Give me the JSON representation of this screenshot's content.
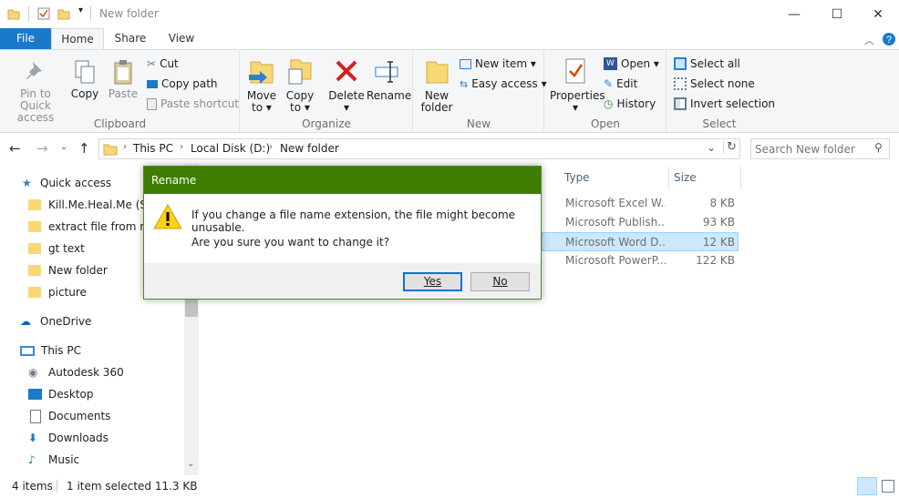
{
  "titlebar": {
    "title": "New folder",
    "minimize": "—",
    "maximize": "☐",
    "close": "✕"
  },
  "tabs": {
    "file": "File",
    "home": "Home",
    "share": "Share",
    "view": "View"
  },
  "ribbon": {
    "clipboard": {
      "label": "Clipboard",
      "pin": "Pin to Quick",
      "pin2": "access",
      "copy": "Copy",
      "paste": "Paste",
      "cut": "Cut",
      "copy_path": "Copy path",
      "paste_shortcut": "Paste shortcut"
    },
    "organize": {
      "label": "Organize",
      "move": "Move",
      "move2": "to ▾",
      "copy": "Copy",
      "copy2": "to ▾",
      "delete": "Delete",
      "delete2": "▾",
      "rename": "Rename"
    },
    "new": {
      "label": "New",
      "new_folder": "New",
      "new_folder2": "folder",
      "new_item": "New item ▾",
      "easy_access": "Easy access ▾"
    },
    "open": {
      "label": "Open",
      "properties": "Properties",
      "properties2": "▾",
      "open": "Open ▾",
      "edit": "Edit",
      "history": "History"
    },
    "select": {
      "label": "Select",
      "select_all": "Select all",
      "select_none": "Select none",
      "invert": "Invert selection"
    }
  },
  "address": {
    "crumbs": [
      "This PC",
      "Local Disk (D:)",
      "New folder"
    ],
    "search_placeholder": "Search New folder"
  },
  "nav": {
    "quick_access": "Quick access",
    "items": [
      "Kill.Me.Heal.Me (Su",
      "extract file from ms",
      "gt text",
      "New folder",
      "picture"
    ],
    "onedrive": "OneDrive",
    "this_pc": "This PC",
    "pc_items": [
      "Autodesk 360",
      "Desktop",
      "Documents",
      "Downloads",
      "Music"
    ]
  },
  "columns": {
    "type": "Type",
    "size": "Size"
  },
  "files": [
    {
      "type": "Microsoft Excel W...",
      "size": "8 KB"
    },
    {
      "type": "Microsoft Publish...",
      "size": "93 KB"
    },
    {
      "type": "Microsoft Word D...",
      "size": "12 KB"
    },
    {
      "type": "Microsoft PowerP...",
      "size": "122 KB"
    }
  ],
  "status": {
    "count": "4 items",
    "selected": "1 item selected  11.3 KB"
  },
  "dialog": {
    "title": "Rename",
    "message": "If you change a file name extension, the file might become unusable.",
    "question": "Are you sure you want to change it?",
    "yes": "Yes",
    "no": "No"
  },
  "colors": {
    "accent": "#1979ca",
    "dialog_title": "#3f7d00",
    "selection": "#cce8ff"
  }
}
